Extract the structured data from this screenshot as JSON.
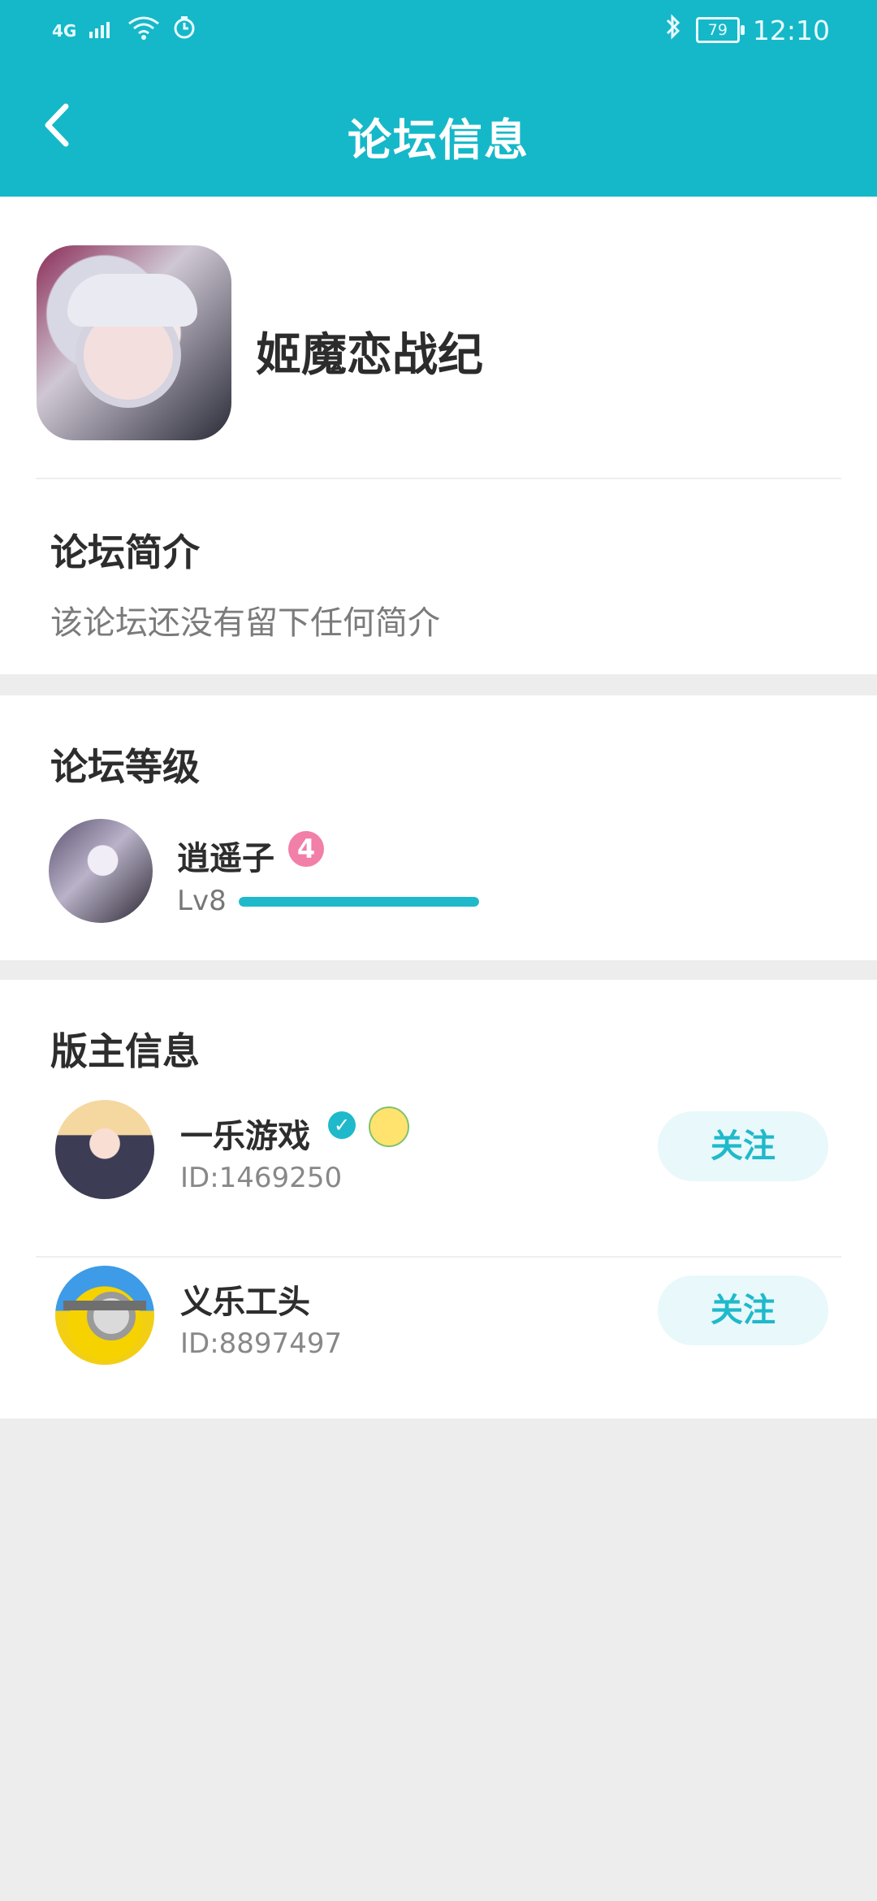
{
  "status_bar": {
    "network": "4G",
    "battery": "79",
    "time": "12:10"
  },
  "header": {
    "title": "论坛信息"
  },
  "game": {
    "name": "姬魔恋战纪"
  },
  "intro": {
    "title": "论坛简介",
    "text": "该论坛还没有留下任何简介"
  },
  "level": {
    "title": "论坛等级",
    "user": "逍遥子",
    "badge": "4",
    "label": "Lv8",
    "progress": 1.0
  },
  "moderators": {
    "title": "版主信息",
    "items": [
      {
        "name": "一乐游戏",
        "id": "ID:1469250",
        "follow_label": "关注"
      },
      {
        "name": "义乐工头",
        "id": "ID:8897497",
        "follow_label": "关注"
      }
    ]
  },
  "colors": {
    "primary": "#15b8c8",
    "badge": "#f17fa7",
    "follow_bg": "#e8f8fb"
  }
}
